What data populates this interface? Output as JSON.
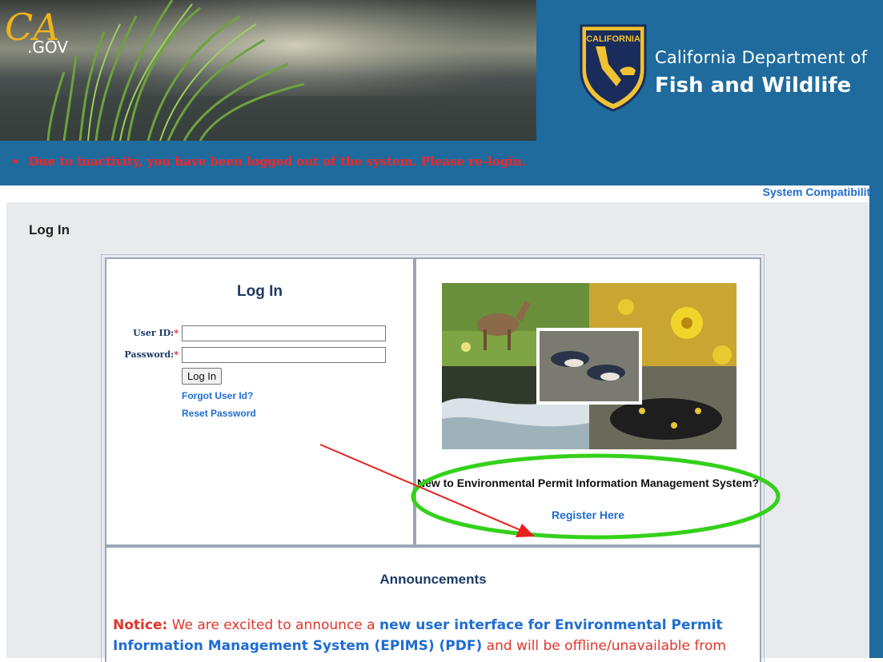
{
  "banner": {
    "ca_logo_text": "CA",
    "ca_logo_suffix": ".GOV",
    "seal_text_top": "CALIFORNIA",
    "seal_text_mid": "DEPARTMENT OF FISH & WILDLIFE",
    "dept_name_line1": "California Department of",
    "dept_name_line2": "Fish and Wildlife",
    "alert_bullet": "•",
    "alert_message": "Due to inactivity, you have been logged out of the system. Please re-login."
  },
  "header_links": {
    "system_compatibility": "System Compatibility"
  },
  "page": {
    "title": "Log In"
  },
  "login": {
    "heading": "Log In",
    "user_id_label": "User ID:",
    "password_label": "Password:",
    "required_marker": "*",
    "user_id_value": "",
    "password_value": "",
    "login_button": "Log In",
    "forgot_user_id": "Forgot User Id?",
    "reset_password": "Reset Password"
  },
  "register": {
    "question": "New to Environmental Permit Information Management System?",
    "link": "Register Here"
  },
  "announcements": {
    "heading": "Announcements",
    "notice_label": "Notice:",
    "notice_text_1": " We are excited to announce a ",
    "notice_highlight": "new user interface for Environmental Permit Information Management System (EPIMS) (PDF)",
    "notice_text_2": " and will be offline/unavailable from"
  },
  "colors": {
    "banner_blue": "#1f6b9d",
    "alert_red": "#ff2222",
    "link_blue": "#1f6dd1",
    "annotation_red": "#e8201a",
    "annotation_green": "#34d11a"
  }
}
